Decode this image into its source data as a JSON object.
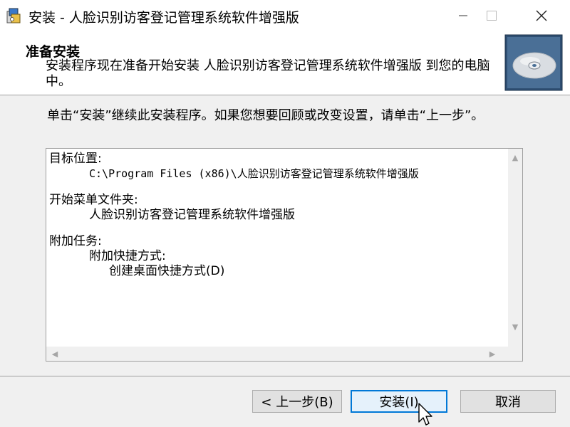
{
  "window": {
    "title": "安装 - 人脸识别访客登记管理系统软件增强版"
  },
  "header": {
    "title": "准备安装",
    "subtitle": "安装程序现在准备开始安装 人脸识别访客登记管理系统软件增强版 到您的电脑中。"
  },
  "intro_text": "单击“安装”继续此安装程序。如果您想要回顾或改变设置，请单击“上一步”。",
  "summary": {
    "dest_label": "目标位置:",
    "dest_path": "C:\\Program Files (x86)\\人脸识别访客登记管理系统软件增强版",
    "start_menu_label": "开始菜单文件夹:",
    "start_menu_value": "人脸识别访客登记管理系统软件增强版",
    "tasks_label": "附加任务:",
    "tasks_group": "附加快捷方式:",
    "tasks_item": "创建桌面快捷方式(D)"
  },
  "buttons": {
    "back": "< 上一步(B)",
    "install": "安装(I)",
    "cancel": "取消"
  },
  "icons": {
    "app": "installer-icon",
    "header_graphic": "cd-disc-icon",
    "minimize": "minimize-icon",
    "maximize": "maximize-icon",
    "close": "close-icon",
    "cursor": "mouse-pointer-icon"
  },
  "colors": {
    "focus_border": "#0078d7",
    "window_bg": "#f0f0f0",
    "panel_bg": "#ffffff"
  }
}
